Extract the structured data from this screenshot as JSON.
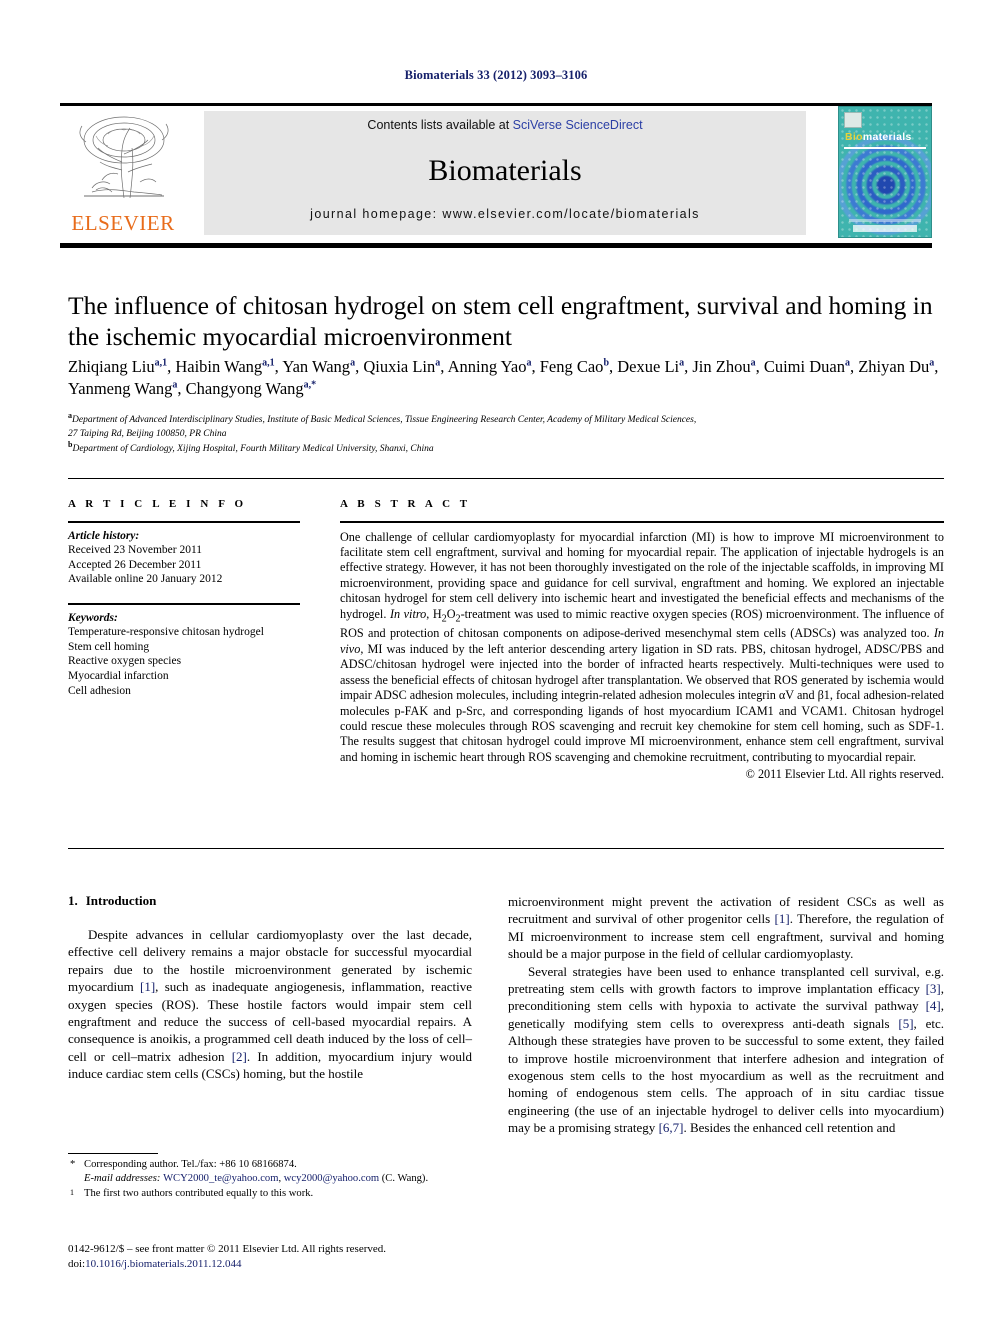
{
  "running_head": "Biomaterials 33 (2012) 3093–3106",
  "masthead": {
    "contents_prefix": "Contents lists available at ",
    "contents_link": "SciVerse ScienceDirect",
    "journal_name": "Biomaterials",
    "homepage": "journal homepage: www.elsevier.com/locate/biomaterials",
    "publisher": "ELSEVIER",
    "cover_title_1": "Bio",
    "cover_title_2": "materials"
  },
  "article": {
    "title": "The influence of chitosan hydrogel on stem cell engraftment, survival and homing in the ischemic myocardial microenvironment",
    "authors": [
      {
        "name": "Zhiqiang Liu",
        "sup": "a,1"
      },
      {
        "name": "Haibin Wang",
        "sup": "a,1"
      },
      {
        "name": "Yan Wang",
        "sup": "a"
      },
      {
        "name": "Qiuxia Lin",
        "sup": "a"
      },
      {
        "name": "Anning Yao",
        "sup": "a"
      },
      {
        "name": "Feng Cao",
        "sup": "b"
      },
      {
        "name": "Dexue Li",
        "sup": "a"
      },
      {
        "name": "Jin Zhou",
        "sup": "a"
      },
      {
        "name": "Cuimi Duan",
        "sup": "a"
      },
      {
        "name": "Zhiyan Du",
        "sup": "a"
      },
      {
        "name": "Yanmeng Wang",
        "sup": "a"
      },
      {
        "name": "Changyong Wang",
        "sup": "a,*"
      }
    ],
    "affiliation_a_mark": "a",
    "affiliation_a_line1": "Department of Advanced Interdisciplinary Studies, Institute of Basic Medical Sciences, Tissue Engineering Research Center, Academy of Military Medical Sciences,",
    "affiliation_a_line2": "27 Taiping Rd, Beijing 100850, PR China",
    "affiliation_b_mark": "b",
    "affiliation_b_line": "Department of Cardiology, Xijing Hospital, Fourth Military Medical University, Shanxi, China"
  },
  "article_info": {
    "heading": "A R T I C L E   I N F O",
    "history_label": "Article history:",
    "history": [
      "Received 23 November 2011",
      "Accepted 26 December 2011",
      "Available online 20 January 2012"
    ],
    "keywords_label": "Keywords:",
    "keywords": [
      "Temperature-responsive chitosan hydrogel",
      "Stem cell homing",
      "Reactive oxygen species",
      "Myocardial infarction",
      "Cell adhesion"
    ]
  },
  "abstract": {
    "heading": "A B S T R A C T",
    "part1": "One challenge of cellular cardiomyoplasty for myocardial infarction (MI) is how to improve MI microenvironment to facilitate stem cell engraftment, survival and homing for myocardial repair. The application of injectable hydrogels is an effective strategy. However, it has not been thoroughly investigated on the role of the injectable scaffolds, in improving MI microenvironment, providing space and guidance for cell survival, engraftment and homing. We explored an injectable chitosan hydrogel for stem cell delivery into ischemic heart and investigated the beneficial effects and mechanisms of the hydrogel. ",
    "italic1": "In vitro",
    "part2": ", H",
    "sub1": "2",
    "part2b": "O",
    "sub2": "2",
    "part3": "-treatment was used to mimic reactive oxygen species (ROS) microenvironment. The influence of ROS and protection of chitosan components on adipose-derived mesenchymal stem cells (ADSCs) was analyzed too. ",
    "italic2": "In vivo",
    "part4": ", MI was induced by the left anterior descending artery ligation in SD rats. PBS, chitosan hydrogel, ADSC/PBS and ADSC/chitosan hydrogel were injected into the border of infracted hearts respectively. Multi-techniques were used to assess the beneficial effects of chitosan hydrogel after transplantation. We observed that ROS generated by ischemia would impair ADSC adhesion molecules, including integrin-related adhesion molecules integrin αV and β1, focal adhesion-related molecules p-FAK and p-Src, and corresponding ligands of host myocardium ICAM1 and VCAM1. Chitosan hydrogel could rescue these molecules through ROS scavenging and recruit key chemokine for stem cell homing, such as SDF-1. The results suggest that chitosan hydrogel could improve MI microenvironment, enhance stem cell engraftment, survival and homing in ischemic heart through ROS scavenging and chemokine recruitment, contributing to myocardial repair.",
    "copyright": "© 2011 Elsevier Ltd. All rights reserved."
  },
  "introduction": {
    "number": "1.",
    "heading": "Introduction",
    "left_p1_a": "Despite advances in cellular cardiomyoplasty over the last decade, effective cell delivery remains a major obstacle for successful myocardial repairs due to the hostile microenvironment generated by ischemic myocardium ",
    "ref1": "[1]",
    "left_p1_b": ", such as inadequate angiogenesis, inflammation, reactive oxygen species (ROS). These hostile factors would impair stem cell engraftment and reduce the success of cell-based myocardial repairs. A consequence is anoikis, a programmed cell death induced by the loss of cell–cell or cell–matrix adhesion ",
    "ref2": "[2]",
    "left_p1_c": ". In addition, myocardium injury would induce cardiac stem cells (CSCs) homing, but the hostile",
    "right_p1_a": "microenvironment might prevent the activation of resident CSCs as well as recruitment and survival of other progenitor cells ",
    "ref3": "[1]",
    "right_p1_b": ". Therefore, the regulation of MI microenvironment to increase stem cell engraftment, survival and homing should be a major purpose in the field of cellular cardiomyoplasty.",
    "right_p2_a": "Several strategies have been used to enhance transplanted cell survival, e.g. pretreating stem cells with growth factors to improve implantation efficacy ",
    "ref4": "[3]",
    "right_p2_b": ", preconditioning stem cells with hypoxia to activate the survival pathway ",
    "ref5": "[4]",
    "right_p2_c": ", genetically modifying stem cells to overexpress anti-death signals ",
    "ref6": "[5]",
    "right_p2_d": ", etc. Although these strategies have proven to be successful to some extent, they failed to improve hostile microenvironment that interfere adhesion and integration of exogenous stem cells to the host myocardium as well as the recruitment and homing of endogenous stem cells. The approach of in situ cardiac tissue engineering (the use of an injectable hydrogel to deliver cells into myocardium) may be a promising strategy ",
    "ref7": "[6,7]",
    "right_p2_e": ". Besides the enhanced cell retention and"
  },
  "footnotes": {
    "corresponding_mark": "*",
    "corresponding_text": "Corresponding author. Tel./fax: +86 10 68166874.",
    "email_label": "E-mail addresses:",
    "email1": "WCY2000_te@yahoo.com",
    "email_sep": ", ",
    "email2": "wcy2000@yahoo.com",
    "email_suffix": " (C. Wang).",
    "equal_mark": "1",
    "equal_text": "The first two authors contributed equally to this work."
  },
  "imprint": {
    "line1": "0142-9612/$ – see front matter © 2011 Elsevier Ltd. All rights reserved.",
    "doi_label": "doi:",
    "doi_value": "10.1016/j.biomaterials.2011.12.044"
  },
  "colors": {
    "link_blue": "#16216b",
    "sciencedirect_blue": "#2b3fa5",
    "elsevier_orange": "#e86c1b",
    "cover_teal": "#3fb4ae",
    "header_gray": "#e6e6e6"
  }
}
